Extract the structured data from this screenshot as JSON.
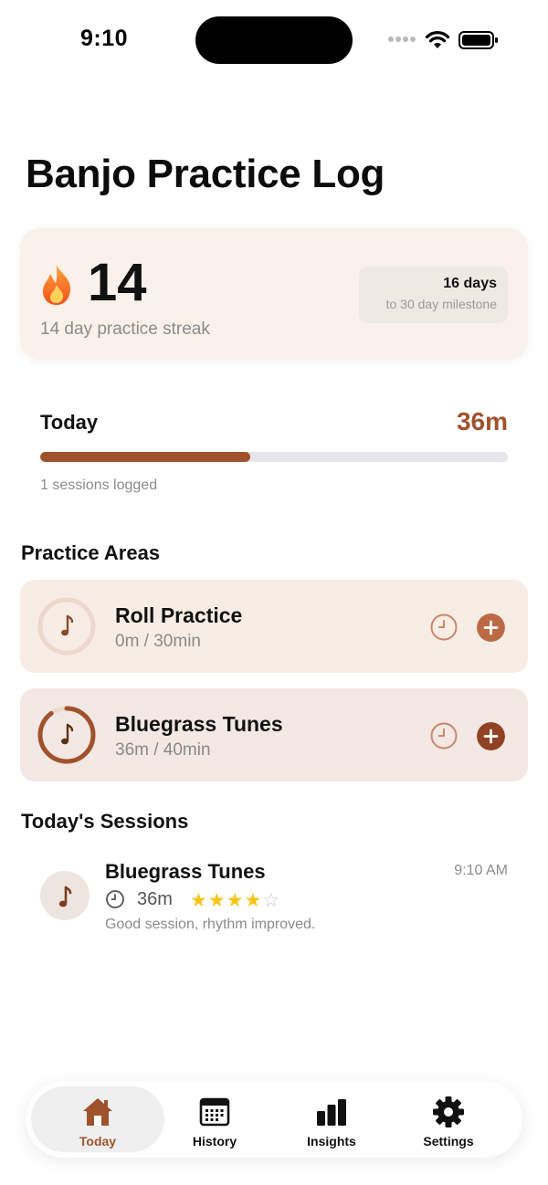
{
  "status_bar": {
    "time": "9:10"
  },
  "page": {
    "title": "Banjo Practice Log"
  },
  "streak": {
    "count": "14",
    "label": "14 day practice streak",
    "milestone_days": "16 days",
    "milestone_caption": "to 30 day milestone"
  },
  "today": {
    "label": "Today",
    "total": "36m",
    "progress_fraction": 0.45,
    "sessions_logged": "1 sessions logged"
  },
  "practice_areas": {
    "title": "Practice Areas",
    "items": [
      {
        "name": "Roll Practice",
        "progress": "0m / 30min",
        "fraction": 0.0
      },
      {
        "name": "Bluegrass Tunes",
        "progress": "36m / 40min",
        "fraction": 0.9
      }
    ]
  },
  "sessions": {
    "title": "Today's Sessions",
    "items": [
      {
        "name": "Bluegrass Tunes",
        "time": "9:10 AM",
        "duration": "36m",
        "rating": 4,
        "rating_max": 5,
        "note": "Good session, rhythm improved."
      }
    ]
  },
  "tabs": [
    {
      "label": "Today",
      "icon": "house-icon",
      "active": true
    },
    {
      "label": "History",
      "icon": "calendar-icon",
      "active": false
    },
    {
      "label": "Insights",
      "icon": "bar-chart-icon",
      "active": false
    },
    {
      "label": "Settings",
      "icon": "gear-icon",
      "active": false
    }
  ],
  "colors": {
    "accent": "#a0522d",
    "card_light": "#f9f1ea",
    "card_area_1": "#f8ede5",
    "card_area_2": "#f3e8e3"
  }
}
